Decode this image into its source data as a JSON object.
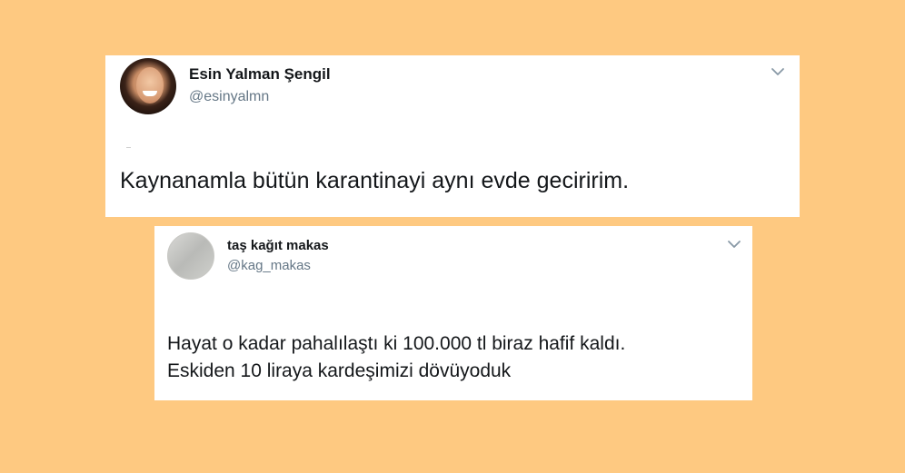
{
  "background_color": "#FEC981",
  "tweets": [
    {
      "display_name": "Esin Yalman Şengil",
      "handle": "@esinyalmn",
      "avatar_icon": "profile-photo-icon",
      "menu_icon": "chevron-down-icon",
      "text_lines": [
        "Kaynanamla bütün karantinayi aynı evde geciririm."
      ]
    },
    {
      "display_name": "taş kağıt makas",
      "handle": "@kag_makas",
      "avatar_icon": "profile-photo-icon",
      "menu_icon": "chevron-down-icon",
      "text_lines": [
        "Hayat o kadar pahalılaştı ki 100.000 tl biraz hafif kaldı.",
        "Eskiden 10 liraya kardeşimizi dövüyoduk"
      ]
    }
  ]
}
